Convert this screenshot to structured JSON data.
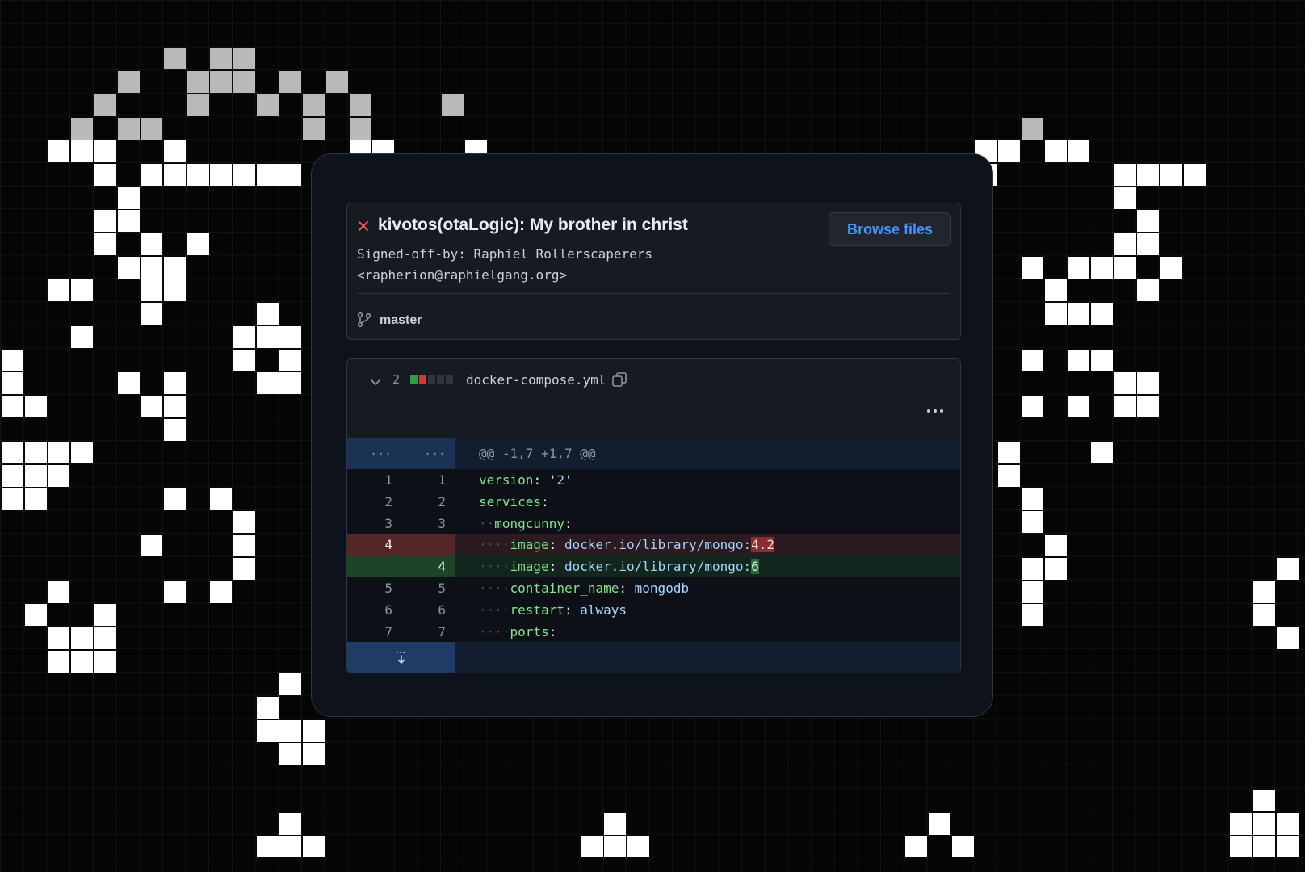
{
  "commit": {
    "status": "failed",
    "title": "kivotos(otaLogic): My brother in christ",
    "body_lines": [
      "Signed-off-by: Raphiel Rollerscaperers",
      "<rapherion@raphielgang.org>"
    ],
    "browse_label": "Browse files",
    "branch": "master"
  },
  "file": {
    "change_count": "2",
    "name": "docker-compose.yml",
    "diffstat": [
      "add",
      "del",
      "neutral",
      "neutral",
      "neutral"
    ]
  },
  "diff": {
    "hunk_gutter_old": "...",
    "hunk_gutter_new": "...",
    "hunk_header": "@@ -1,7 +1,7 @@",
    "lines": [
      {
        "type": "ctx",
        "old": "1",
        "new": "1"
      },
      {
        "type": "ctx",
        "old": "2",
        "new": "2"
      },
      {
        "type": "ctx",
        "old": "3",
        "new": "3"
      },
      {
        "type": "del",
        "old": "4",
        "new": ""
      },
      {
        "type": "add",
        "old": "",
        "new": "4"
      },
      {
        "type": "ctx",
        "old": "5",
        "new": "5"
      },
      {
        "type": "ctx",
        "old": "6",
        "new": "6"
      },
      {
        "type": "ctx",
        "old": "7",
        "new": "7"
      }
    ],
    "tokens": {
      "version_key": "version",
      "version_val": "'2'",
      "services_key": "services",
      "mongcunny_key": "mongcunny",
      "image_key": "image",
      "image_base": "docker.io/library/mongo:",
      "image_old_tag": "4.2",
      "image_new_tag": "6",
      "container_key": "container_name",
      "container_val": "mongodb",
      "restart_key": "restart",
      "restart_val": "always",
      "ports_key": "ports"
    }
  },
  "colors": {
    "accent": "#4493f8",
    "error": "#f85149",
    "added": "#2ea043",
    "removed": "#da3633"
  }
}
